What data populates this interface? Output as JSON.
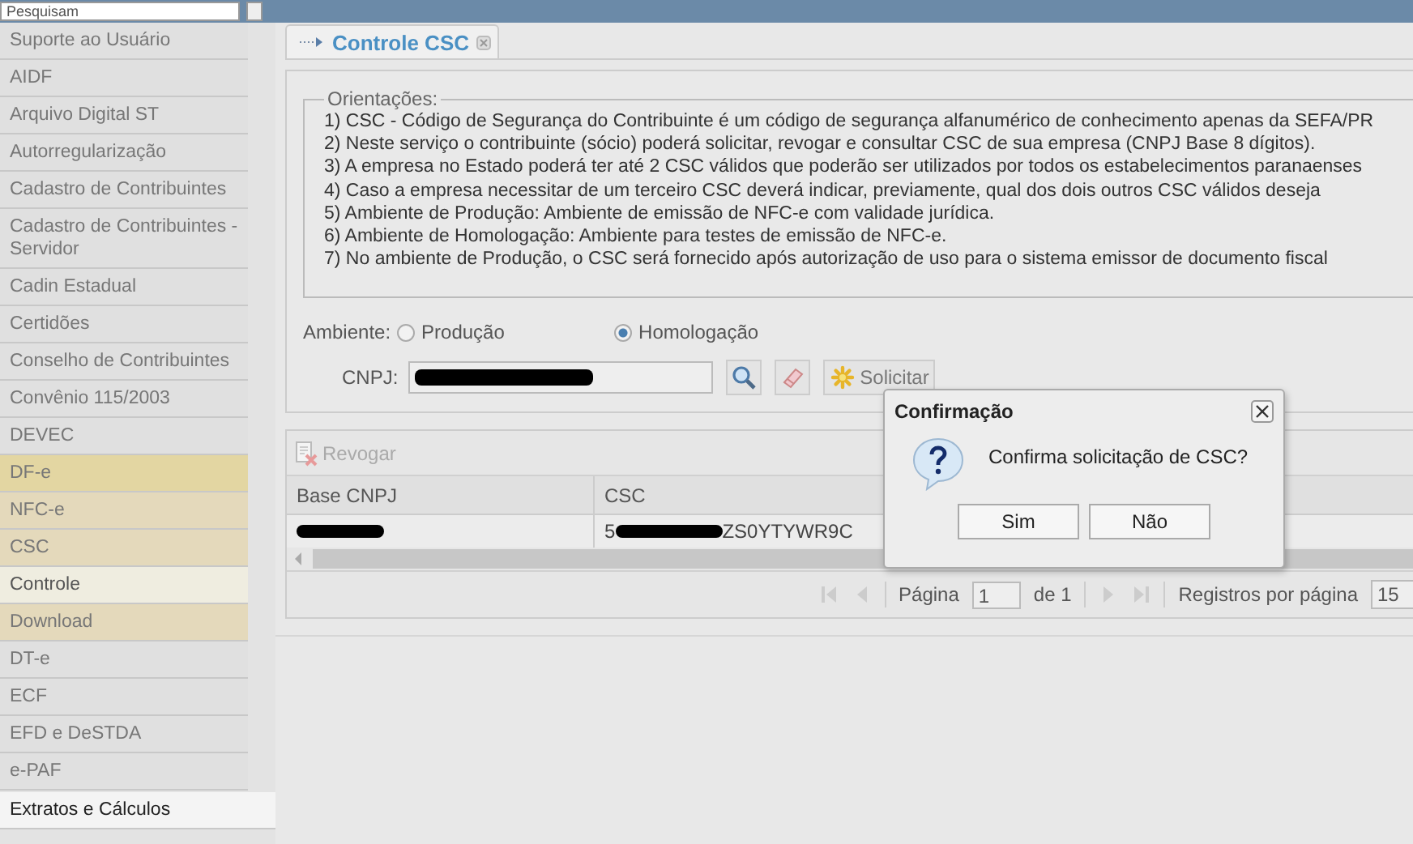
{
  "top_bar": {
    "search": {
      "value": "Pesquisam"
    }
  },
  "sidebar": {
    "items": [
      {
        "label": "Suporte ao Usuário",
        "selected": false,
        "hovered": false
      },
      {
        "label": "AIDF",
        "selected": false,
        "hovered": false
      },
      {
        "label": "Arquivo Digital ST",
        "selected": false,
        "hovered": false
      },
      {
        "label": "Autorregularização",
        "selected": false,
        "hovered": false
      },
      {
        "label": "Cadastro de Contribuintes",
        "selected": false,
        "hovered": false
      },
      {
        "label": "Cadastro de Contribuintes - Servidor",
        "selected": false,
        "hovered": false
      },
      {
        "label": "Cadin Estadual",
        "selected": false,
        "hovered": false
      },
      {
        "label": "Certidões",
        "selected": false,
        "hovered": false
      },
      {
        "label": "Conselho de Contribuintes",
        "selected": false,
        "hovered": false
      },
      {
        "label": "Convênio 115/2003",
        "selected": false,
        "hovered": false
      },
      {
        "label": "DEVEC",
        "selected": false,
        "hovered": false
      },
      {
        "label": "DF-e",
        "selected": false,
        "hovered": false,
        "expanded": true,
        "children": [
          {
            "label": "NFC-e",
            "selected": false,
            "hovered": false,
            "expanded": true,
            "children": [
              {
                "label": "CSC",
                "selected": false,
                "hovered": false,
                "expanded": true,
                "children": [
                  {
                    "label": "Controle",
                    "selected": true,
                    "hovered": false
                  }
                ]
              },
              {
                "label": "Download",
                "selected": false,
                "hovered": false
              }
            ]
          }
        ]
      },
      {
        "label": "DT-e",
        "selected": false,
        "hovered": false
      },
      {
        "label": "ECF",
        "selected": false,
        "hovered": false
      },
      {
        "label": "EFD e DeSTDA",
        "selected": false,
        "hovered": false
      },
      {
        "label": "e-PAF",
        "selected": false,
        "hovered": false
      },
      {
        "label": "Extratos e Cálculos",
        "selected": false,
        "hovered": true
      }
    ]
  },
  "tab": {
    "title": "Controle CSC"
  },
  "guidance": {
    "legend": "Orientações:",
    "lines": [
      "1) CSC - Código de Segurança do Contribuinte é um código de segurança alfanumérico de conhecimento apenas da SEFA/PR",
      "2) Neste serviço o contribuinte (sócio) poderá solicitar, revogar e consultar CSC de sua empresa (CNPJ Base 8 dígitos).",
      "3) A empresa no Estado poderá ter até 2 CSC válidos que poderão ser utilizados por todos os estabelecimentos paranaenses",
      "4) Caso a empresa necessitar de um terceiro CSC deverá indicar, previamente, qual dos dois outros CSC válidos deseja",
      "5) Ambiente de Produção: Ambiente de emissão de NFC-e com validade jurídica.",
      "6) Ambiente de Homologação: Ambiente para testes de emissão de NFC-e.",
      "7) No ambiente de Produção, o CSC será fornecido após autorização de uso para o sistema emissor de documento fiscal"
    ]
  },
  "environment": {
    "label": "Ambiente:",
    "options": [
      {
        "label": "Produção",
        "selected": false
      },
      {
        "label": "Homologação",
        "selected": true
      }
    ]
  },
  "cnpj": {
    "label": "CNPJ:",
    "redacted": true
  },
  "request_button": {
    "label": "Solicitar"
  },
  "grid": {
    "revoke_button": {
      "label": "Revogar",
      "disabled": true
    },
    "columns": [
      "Base CNPJ",
      "CSC"
    ],
    "rows": [
      {
        "base_cnpj_redacted": true,
        "csc_prefix": "5",
        "csc_suffix": "ZS0YTYWR9C"
      }
    ]
  },
  "pager": {
    "page_label": "Página",
    "page": "1",
    "of": "de 1",
    "per_page_label": "Registros por página",
    "per_page": "15"
  },
  "dialog": {
    "title": "Confirmação",
    "message": "Confirma solicitação de CSC?",
    "buttons": [
      "Sim",
      "Não"
    ]
  }
}
